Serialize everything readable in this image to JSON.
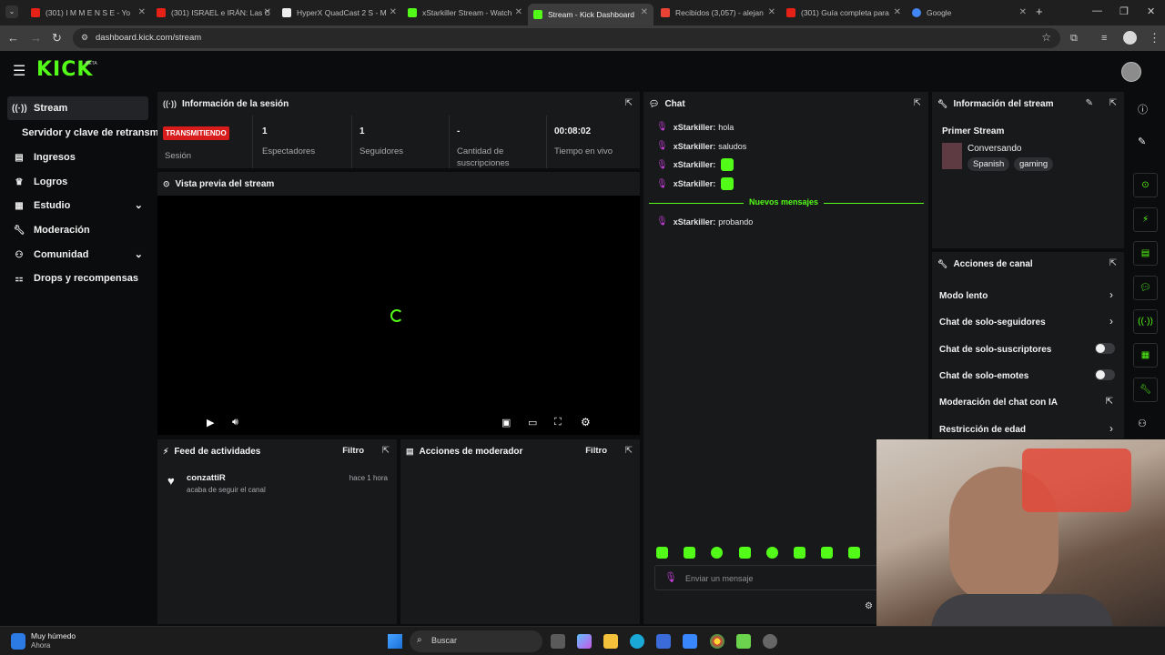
{
  "browser": {
    "tabs": [
      {
        "title": "(301) I M M E N S E - Yo",
        "favicon_color": "#e62117"
      },
      {
        "title": "(301) ISRAEL e IRÁN: Las C",
        "favicon_color": "#e62117"
      },
      {
        "title": "HyperX QuadCast 2 S - M",
        "favicon_color": "#eeeeee"
      },
      {
        "title": "xStarkiller Stream - Watch",
        "favicon_color": "#53fc18"
      },
      {
        "title": "Stream - Kick Dashboard",
        "favicon_color": "#53fc18"
      },
      {
        "title": "Recibidos (3,057) - alejan",
        "favicon_color": "#ea4335"
      },
      {
        "title": "(301) Guía completa para",
        "favicon_color": "#e62117"
      },
      {
        "title": "Google",
        "favicon_color": "#4285f4"
      }
    ],
    "url": "dashboard.kick.com/stream"
  },
  "header": {
    "logo": "KICK",
    "logo_tag": "BETA"
  },
  "sidebar": {
    "items": [
      {
        "label": "Stream",
        "icon": "broadcast-icon"
      },
      {
        "label": "Servidor y clave de retransm",
        "icon": ""
      },
      {
        "label": "Ingresos",
        "icon": "chart-icon"
      },
      {
        "label": "Logros",
        "icon": "trophy-icon"
      },
      {
        "label": "Estudio",
        "icon": "studio-icon"
      },
      {
        "label": "Moderación",
        "icon": "wrench-icon"
      },
      {
        "label": "Comunidad",
        "icon": "community-icon"
      },
      {
        "label": "Drops y recompensas",
        "icon": "drops-icon"
      }
    ]
  },
  "session": {
    "title": "Información de la sesión",
    "badge": "TRANSMITIENDO",
    "session_label": "Sesión",
    "stats": [
      {
        "value": "1",
        "label": "Espectadores"
      },
      {
        "value": "1",
        "label": "Seguidores"
      },
      {
        "value": "-",
        "label": "Cantidad de suscripciones"
      },
      {
        "value": "00:08:02",
        "label": "Tiempo en vivo"
      }
    ]
  },
  "preview": {
    "title": "Vista previa del stream"
  },
  "feed": {
    "title": "Feed de actividades",
    "filter": "Filtro",
    "items": [
      {
        "user": "conzattiR",
        "text": "acaba de seguir el canal",
        "time": "hace 1 hora"
      }
    ]
  },
  "modactions": {
    "title": "Acciones de moderador",
    "filter": "Filtro"
  },
  "chat": {
    "title": "Chat",
    "messages": [
      {
        "user": "xStarkiller:",
        "text": "hola"
      },
      {
        "user": "xStarkiller:",
        "text": "saludos"
      },
      {
        "user": "xStarkiller:",
        "text": ""
      },
      {
        "user": "xStarkiller:",
        "text": ""
      }
    ],
    "new_messages": "Nuevos mensajes",
    "new": [
      {
        "user": "xStarkiller:",
        "text": "probando"
      }
    ],
    "placeholder": "Enviar un mensaje"
  },
  "stream_info": {
    "title": "Información del stream",
    "stream_title": "Primer Stream",
    "category": "Conversando",
    "tags": [
      "Spanish",
      "gaming"
    ]
  },
  "channel_actions": {
    "title": "Acciones de canal",
    "items": [
      {
        "label": "Modo lento",
        "control": "chevron"
      },
      {
        "label": "Chat de solo-seguidores",
        "control": "chevron"
      },
      {
        "label": "Chat de solo-suscriptores",
        "control": "toggle"
      },
      {
        "label": "Chat de solo-emotes",
        "control": "toggle"
      },
      {
        "label": "Moderación del chat con IA",
        "control": "external"
      },
      {
        "label": "Restricción de edad",
        "control": "chevron"
      }
    ]
  },
  "taskbar": {
    "weather_title": "Muy húmedo",
    "weather_sub": "Ahora",
    "search": "Buscar"
  },
  "colors": {
    "accent": "#53fc18",
    "live": "#d81b1b",
    "panel": "#18191b"
  }
}
